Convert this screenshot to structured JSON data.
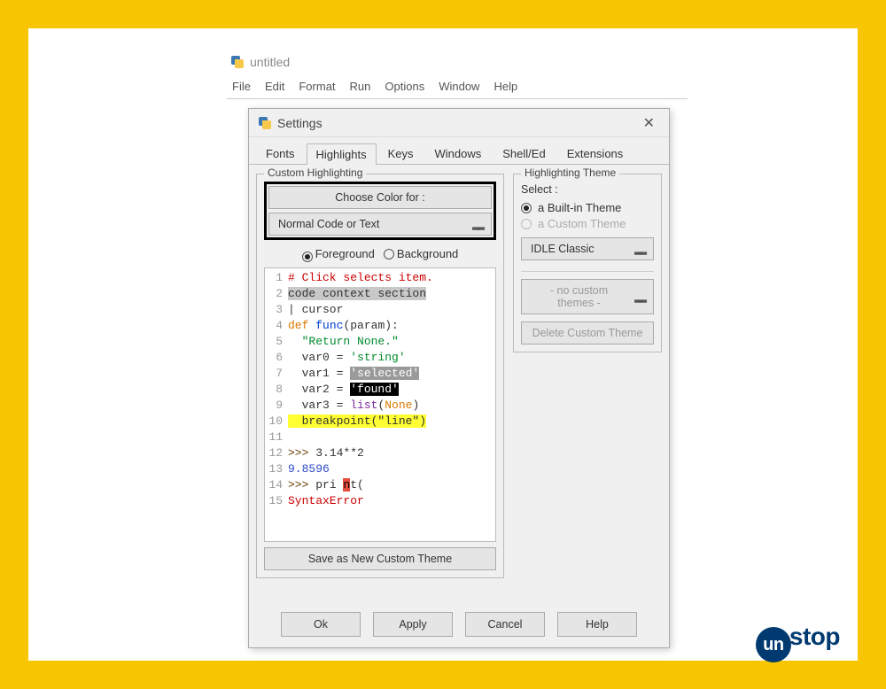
{
  "editor": {
    "title": "untitled"
  },
  "menu": [
    "File",
    "Edit",
    "Format",
    "Run",
    "Options",
    "Window",
    "Help"
  ],
  "dialog": {
    "title": "Settings",
    "tabs": [
      "Fonts",
      "Highlights",
      "Keys",
      "Windows",
      "Shell/Ed",
      "Extensions"
    ],
    "active_tab": "Highlights",
    "custom_legend": "Custom Highlighting",
    "choose_color_label": "Choose Color for :",
    "element_selector": "Normal Code or Text",
    "fg_label": "Foreground",
    "bg_label": "Background",
    "fg_selected": true,
    "save_theme_label": "Save as New Custom Theme",
    "highlight_legend": "Highlighting Theme",
    "select_label": "Select :",
    "builtin_label": "a Built-in Theme",
    "custom_label": "a Custom Theme",
    "builtin_selected": true,
    "builtin_theme": "IDLE Classic",
    "custom_theme": "- no custom themes -",
    "delete_label": "Delete Custom Theme",
    "buttons": {
      "ok": "Ok",
      "apply": "Apply",
      "cancel": "Cancel",
      "help": "Help"
    }
  },
  "code": {
    "lines": [
      {
        "n": 1,
        "plain": "# Click selects item.",
        "cls": "c-comment"
      },
      {
        "n": 2,
        "plain": "code context section",
        "cls": "c-context"
      },
      {
        "n": 3,
        "plain": "| cursor"
      },
      {
        "n": 4,
        "kw": "def",
        "def": "func",
        "rest": "(param):"
      },
      {
        "n": 5,
        "ind": "  ",
        "str": "\"Return None.\""
      },
      {
        "n": 6,
        "ind": "  ",
        "pre": "var0 = ",
        "str": "'string'"
      },
      {
        "n": 7,
        "ind": "  ",
        "pre": "var1 = ",
        "sel": "'selected'"
      },
      {
        "n": 8,
        "ind": "  ",
        "pre": "var2 = ",
        "found": "'found'"
      },
      {
        "n": 9,
        "ind": "  ",
        "pre": "var3 = ",
        "builtin": "list",
        "after": "(",
        "kw2": "None",
        "close": ")"
      },
      {
        "n": 10,
        "break": "  breakpoint(\"line\")"
      },
      {
        "n": 11,
        "plain": ""
      },
      {
        "n": 12,
        "prompt": ">>> ",
        "expr": "3.14**2"
      },
      {
        "n": 13,
        "out": "9.8596"
      },
      {
        "n": 14,
        "prompt": ">>> ",
        "pri": "pri ",
        "errch": "n",
        "post": "t("
      },
      {
        "n": 15,
        "err": "SyntaxError"
      }
    ]
  },
  "logo": {
    "circle": "un",
    "rest": "stop"
  }
}
